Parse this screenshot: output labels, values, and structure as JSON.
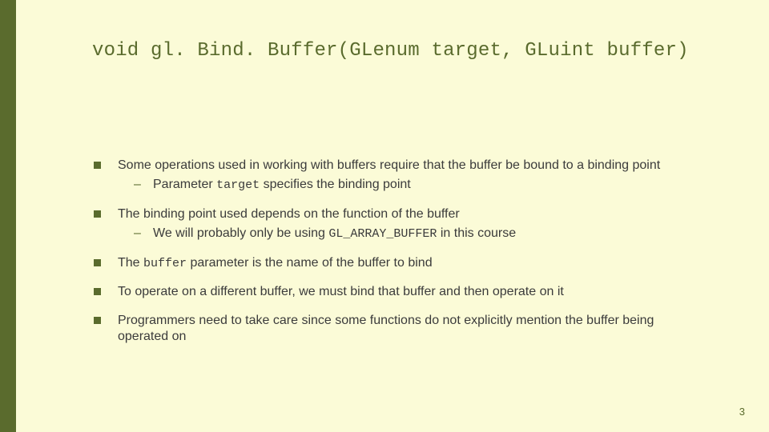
{
  "title": "void gl. Bind. Buffer(GLenum target, GLuint buffer)",
  "bullets": [
    {
      "text": "Some operations used in working with buffers require that the buffer be bound to a binding point",
      "sub": [
        {
          "pre": "Parameter ",
          "code": "target",
          "post": " specifies the binding point"
        }
      ]
    },
    {
      "text": "The binding point used depends on the function of the buffer",
      "sub": [
        {
          "pre": "We will probably only be using ",
          "code": "GL_ARRAY_BUFFER",
          "post": " in this course"
        }
      ]
    },
    {
      "pre": "The ",
      "code": "buffer",
      "post": " parameter is the name of the buffer to bind"
    },
    {
      "text": "To operate on a different buffer, we must bind that buffer and then operate on it"
    },
    {
      "text": "Programmers need to take care since some functions do not explicitly mention the buffer being operated on"
    }
  ],
  "pagenum": "3"
}
